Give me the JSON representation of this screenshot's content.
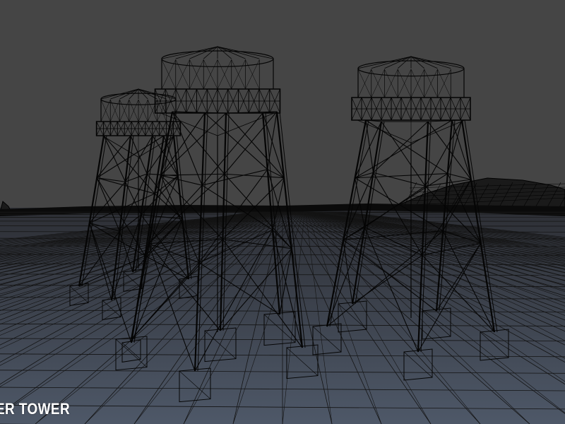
{
  "caption": {
    "text": "ER TOWER"
  },
  "colors": {
    "sky": "#454545",
    "ground_top": "#2d2f35",
    "ground_bottom": "#4e5868",
    "horizon_band": "#0a0a0a",
    "wire": "#050505",
    "ground_wire": "#141414",
    "caption": "#ffffff"
  }
}
